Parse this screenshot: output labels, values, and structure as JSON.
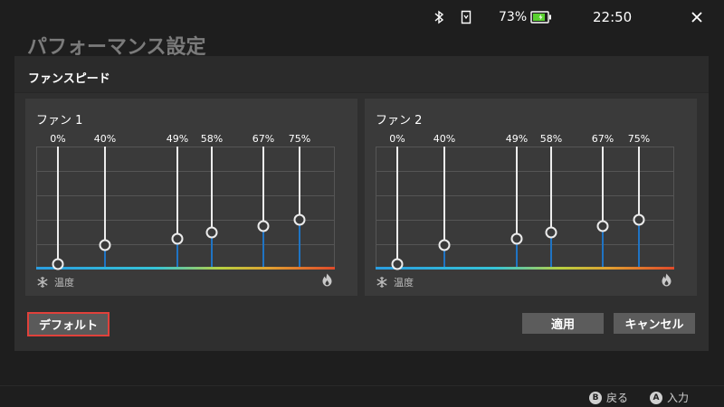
{
  "status": {
    "battery": "73%",
    "time": "22:50"
  },
  "page_title": "パフォーマンス設定",
  "dialog": {
    "title": "ファンスピード",
    "panels": [
      {
        "title": "ファン 1",
        "temp_label": "温度",
        "speeds": [
          {
            "label": "0%",
            "value": 0
          },
          {
            "label": "40%",
            "value": 40
          },
          {
            "label": "49%",
            "value": 49
          },
          {
            "label": "58%",
            "value": 58
          },
          {
            "label": "67%",
            "value": 67
          },
          {
            "label": "75%",
            "value": 75
          }
        ]
      },
      {
        "title": "ファン 2",
        "temp_label": "温度",
        "speeds": [
          {
            "label": "0%",
            "value": 0
          },
          {
            "label": "40%",
            "value": 40
          },
          {
            "label": "49%",
            "value": 49
          },
          {
            "label": "58%",
            "value": 58
          },
          {
            "label": "67%",
            "value": 67
          },
          {
            "label": "75%",
            "value": 75
          }
        ]
      }
    ],
    "buttons": {
      "default": "デフォルト",
      "apply": "適用",
      "cancel": "キャンセル"
    }
  },
  "footer": [
    {
      "key": "B",
      "label": "戻る"
    },
    {
      "key": "A",
      "label": "入力"
    }
  ],
  "colors": {
    "accent": "#1f74c4",
    "focus": "#e0413b"
  },
  "icons": [
    "bluetooth-icon",
    "sd-card-icon",
    "battery-icon",
    "close-icon",
    "snowflake-icon",
    "flame-icon"
  ]
}
